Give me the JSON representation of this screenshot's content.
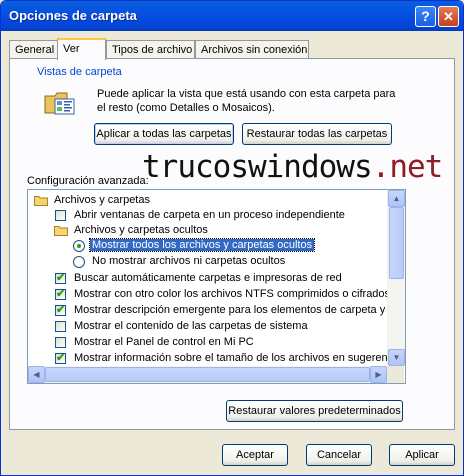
{
  "window": {
    "title": "Opciones de carpeta",
    "help_glyph": "?",
    "close_glyph": "✕"
  },
  "tabs": [
    {
      "label": "General"
    },
    {
      "label": "Ver"
    },
    {
      "label": "Tipos de archivo"
    },
    {
      "label": "Archivos sin conexión"
    }
  ],
  "folder_views": {
    "group_label": "Vistas de carpeta",
    "description": "Puede aplicar la vista que está usando con esta carpeta para el resto (como Detalles o Mosaicos).",
    "apply_all_label": "Aplicar a todas las carpetas",
    "reset_all_label": "Restaurar todas las carpetas"
  },
  "advanced": {
    "label": "Configuración avanzada:",
    "items": [
      {
        "text": "Archivos y carpetas",
        "kind": "folder",
        "level": 0
      },
      {
        "text": "Abrir ventanas de carpeta  en un proceso independiente",
        "kind": "checkbox",
        "checked": false,
        "level": 1
      },
      {
        "text": "Archivos y carpetas ocultos",
        "kind": "folder",
        "level": 1
      },
      {
        "text": "Mostrar todos los archivos y carpetas ocultos",
        "kind": "radio",
        "checked": true,
        "level": 2,
        "selected": true
      },
      {
        "text": "No mostrar archivos ni carpetas ocultos",
        "kind": "radio",
        "checked": false,
        "level": 2
      },
      {
        "text": "Buscar automáticamente carpetas e impresoras de red",
        "kind": "checkbox",
        "checked": true,
        "level": 1
      },
      {
        "text": "Mostrar con otro color los archivos NTFS comprimidos o cifrados",
        "kind": "checkbox",
        "checked": true,
        "level": 1
      },
      {
        "text": "Mostrar descripción emergente para los elementos de carpeta y es",
        "kind": "checkbox",
        "checked": true,
        "level": 1
      },
      {
        "text": "Mostrar el contenido de las carpetas de sistema",
        "kind": "checkbox",
        "checked": false,
        "level": 1
      },
      {
        "text": "Mostrar el Panel de control en Mi PC",
        "kind": "checkbox",
        "checked": false,
        "level": 1
      },
      {
        "text": "Mostrar información sobre el tamaño de los archivos en sugerencia",
        "kind": "checkbox",
        "checked": true,
        "level": 1
      }
    ]
  },
  "restore_defaults_label": "Restaurar valores predeterminados",
  "footer": {
    "ok_label": "Aceptar",
    "cancel_label": "Cancelar",
    "apply_label": "Aplicar"
  },
  "watermark": {
    "part1": "trucoswindows",
    "dot": ".",
    "part2": "net"
  },
  "colors": {
    "title_bar": "#0550e2",
    "accent": "#316ac5",
    "watermark_accent": "#8e1e23",
    "group_label": "#0046d5"
  },
  "icons": {
    "help": "help-icon",
    "close": "close-icon",
    "folder": "folder-icon",
    "folder_options": "folder-options-icon"
  }
}
